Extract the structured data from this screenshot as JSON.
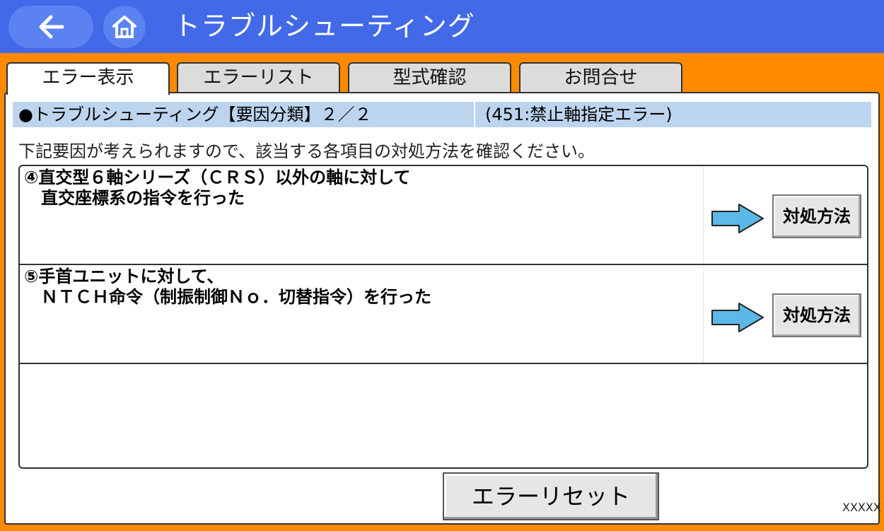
{
  "header": {
    "title": "トラブルシューティング",
    "back_icon": "arrow-left-icon",
    "home_icon": "home-icon",
    "bar_color": "#4169e8",
    "frame_color": "#ff8a00"
  },
  "tabs": [
    {
      "label": "エラー表示",
      "active": true
    },
    {
      "label": "エラーリスト",
      "active": false
    },
    {
      "label": "型式確認",
      "active": false
    },
    {
      "label": "お問合せ",
      "active": false
    }
  ],
  "main": {
    "section_title": "●トラブルシューティング【要因分類】２／２",
    "error_info": "(451:禁止軸指定エラー)",
    "description": "下記要因が考えられますので、該当する各項目の対処方法を確認ください。",
    "items": [
      {
        "text": "④直交型６軸シリーズ（ＣＲＳ）以外の軸に対して\n　直交座標系の指令を行った",
        "button_label": "対処方法"
      },
      {
        "text": "⑤手首ユニットに対して、\n　ＮＴＣＨ命令（制振制御Ｎｏ．切替指令）を行った",
        "button_label": "対処方法"
      }
    ],
    "reset_label": "エラーリセット",
    "footer_code": "XXXXX"
  }
}
